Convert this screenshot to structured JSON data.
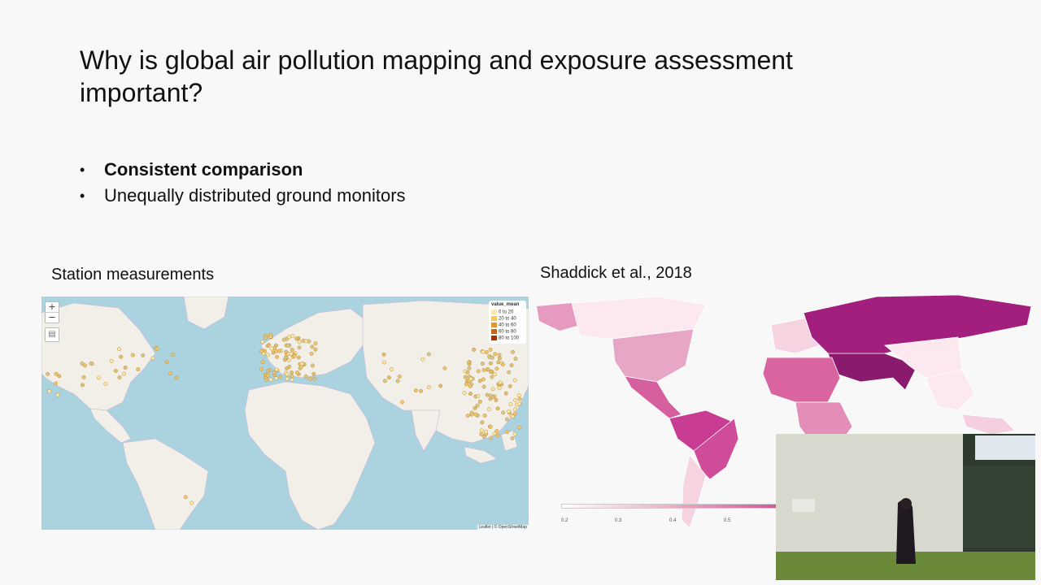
{
  "slide": {
    "title": "Why is global air pollution mapping and exposure assessment important?",
    "bullets": [
      {
        "text": "Consistent comparison",
        "bold": true
      },
      {
        "text": "Unequally distributed ground monitors",
        "bold": false
      }
    ],
    "caption_left": "Station measurements",
    "caption_right": "Shaddick et al., 2018"
  },
  "left_map": {
    "zoom_in": "+",
    "zoom_out": "−",
    "layers_icon": "layers-icon",
    "legend": {
      "title": "value_mean",
      "items": [
        {
          "label": "0 to 20",
          "color": "#fde9a8"
        },
        {
          "label": "20 to 40",
          "color": "#f4c56a"
        },
        {
          "label": "40 to 60",
          "color": "#e0973a"
        },
        {
          "label": "60 to 80",
          "color": "#c4641e"
        },
        {
          "label": "80 to 100",
          "color": "#9b3410"
        }
      ]
    },
    "attribution": "Leaflet | © OpenStreetMap",
    "colors": {
      "ocean": "#aad3df",
      "land": "#f2efe9"
    }
  },
  "right_map": {
    "scale_ticks": [
      "0.2",
      "0.3",
      "0.4",
      "0.5"
    ],
    "colors": {
      "low": "#fbe9ef",
      "mid": "#e79ac0",
      "high": "#c2328c",
      "top": "#8a1a6e"
    }
  }
}
